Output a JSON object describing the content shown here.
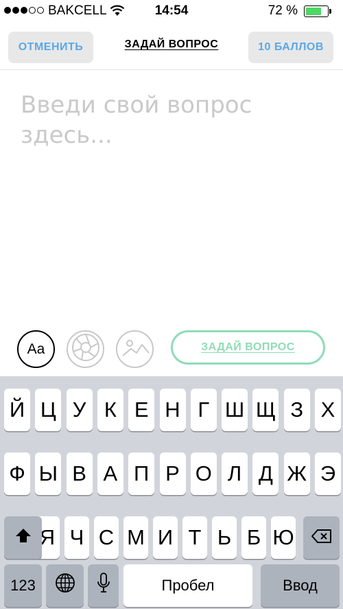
{
  "status_bar": {
    "carrier": "BAKCELL",
    "time": "14:54",
    "battery_percent": "72 %",
    "signal_bars_filled": 3,
    "signal_bars_total": 5,
    "battery_level": 0.72,
    "battery_color": "#4cd964"
  },
  "nav": {
    "cancel_label": "ОТМЕНИТЬ",
    "title": "ЗАДАЙ ВОПРОС",
    "points_label": "10 БАЛЛОВ"
  },
  "question": {
    "placeholder": "Введи свой вопрос здесь...",
    "value": ""
  },
  "tools": {
    "font_label": "Aa",
    "camera_icon": "camera-aperture-icon",
    "image_icon": "image-icon",
    "ask_label": "ЗАДАЙ ВОПРОС",
    "accent_color": "#8fdcb5"
  },
  "keyboard": {
    "row1": [
      "Й",
      "Ц",
      "У",
      "К",
      "Е",
      "Н",
      "Г",
      "Ш",
      "Щ",
      "З",
      "Х"
    ],
    "row2": [
      "Ф",
      "Ы",
      "В",
      "А",
      "П",
      "Р",
      "О",
      "Л",
      "Д",
      "Ж",
      "Э"
    ],
    "row3": [
      "Я",
      "Ч",
      "С",
      "М",
      "И",
      "Т",
      "Ь",
      "Б",
      "Ю"
    ],
    "numbers_label": "123",
    "space_label": "Пробел",
    "return_label": "Ввод"
  }
}
